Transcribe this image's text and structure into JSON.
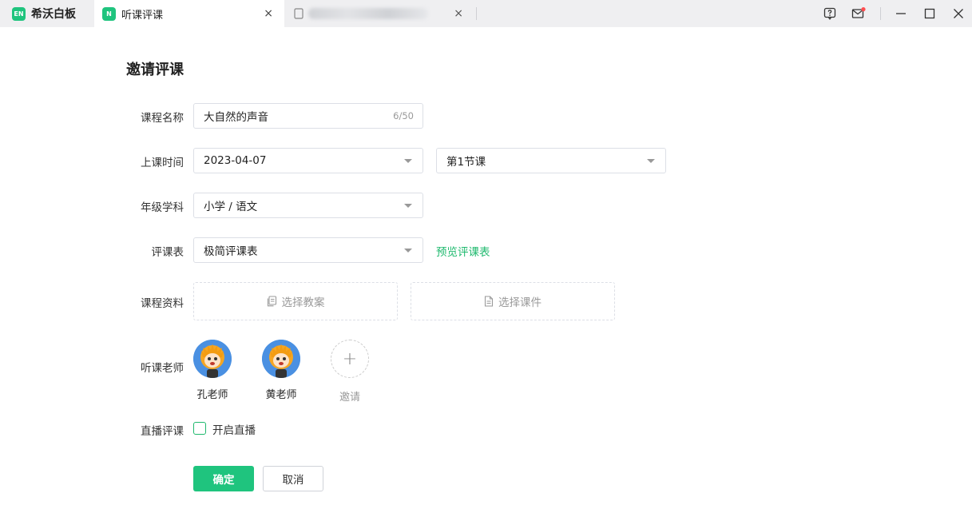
{
  "titlebar": {
    "app_logo": "EN",
    "app_name": "希沃白板",
    "active_tab": {
      "logo": "N",
      "label": "听课评课",
      "close": "×"
    },
    "blurred_tab": {
      "close": "×"
    },
    "icons": [
      "help-icon",
      "mail-icon",
      "minimize-icon",
      "maximize-icon",
      "close-icon"
    ],
    "mail_badge_color": "#ff4d4f"
  },
  "page": {
    "title": "邀请评课"
  },
  "form": {
    "course_name": {
      "label": "课程名称",
      "value": "大自然的声音",
      "counter": "6/50"
    },
    "class_time": {
      "label": "上课时间",
      "date": "2023-04-07",
      "period": "第1节课"
    },
    "grade_subject": {
      "label": "年级学科",
      "value": "小学 / 语文"
    },
    "evaluation_form": {
      "label": "评课表",
      "value": "极简评课表",
      "preview_link": "预览评课表"
    },
    "materials": {
      "label": "课程资料",
      "lesson_plan": "选择教案",
      "courseware": "选择课件"
    },
    "teachers": {
      "label": "听课老师",
      "list": [
        {
          "name": "孔老师"
        },
        {
          "name": "黄老师"
        }
      ],
      "invite_label": "邀请",
      "invite_symbol": "+"
    },
    "live": {
      "label": "直播评课",
      "checkbox_label": "开启直播",
      "checked": false
    },
    "buttons": {
      "confirm": "确定",
      "cancel": "取消"
    }
  },
  "colors": {
    "accent": "#1fc47e",
    "link": "#1fb96e"
  }
}
